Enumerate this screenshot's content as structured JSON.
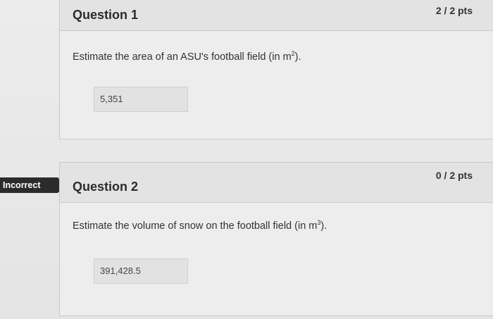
{
  "questions": [
    {
      "title": "Question 1",
      "points": "2 / 2 pts",
      "text_before": "Estimate the area of an ASU's football field (in m",
      "sup": "2",
      "text_after": ").",
      "answer": "5,351"
    },
    {
      "title": "Question 2",
      "points": "0 / 2 pts",
      "text_before": "Estimate the volume of snow on the football field (in m",
      "sup": "3",
      "text_after": ").",
      "answer": "391,428.5",
      "status": "Incorrect"
    }
  ]
}
